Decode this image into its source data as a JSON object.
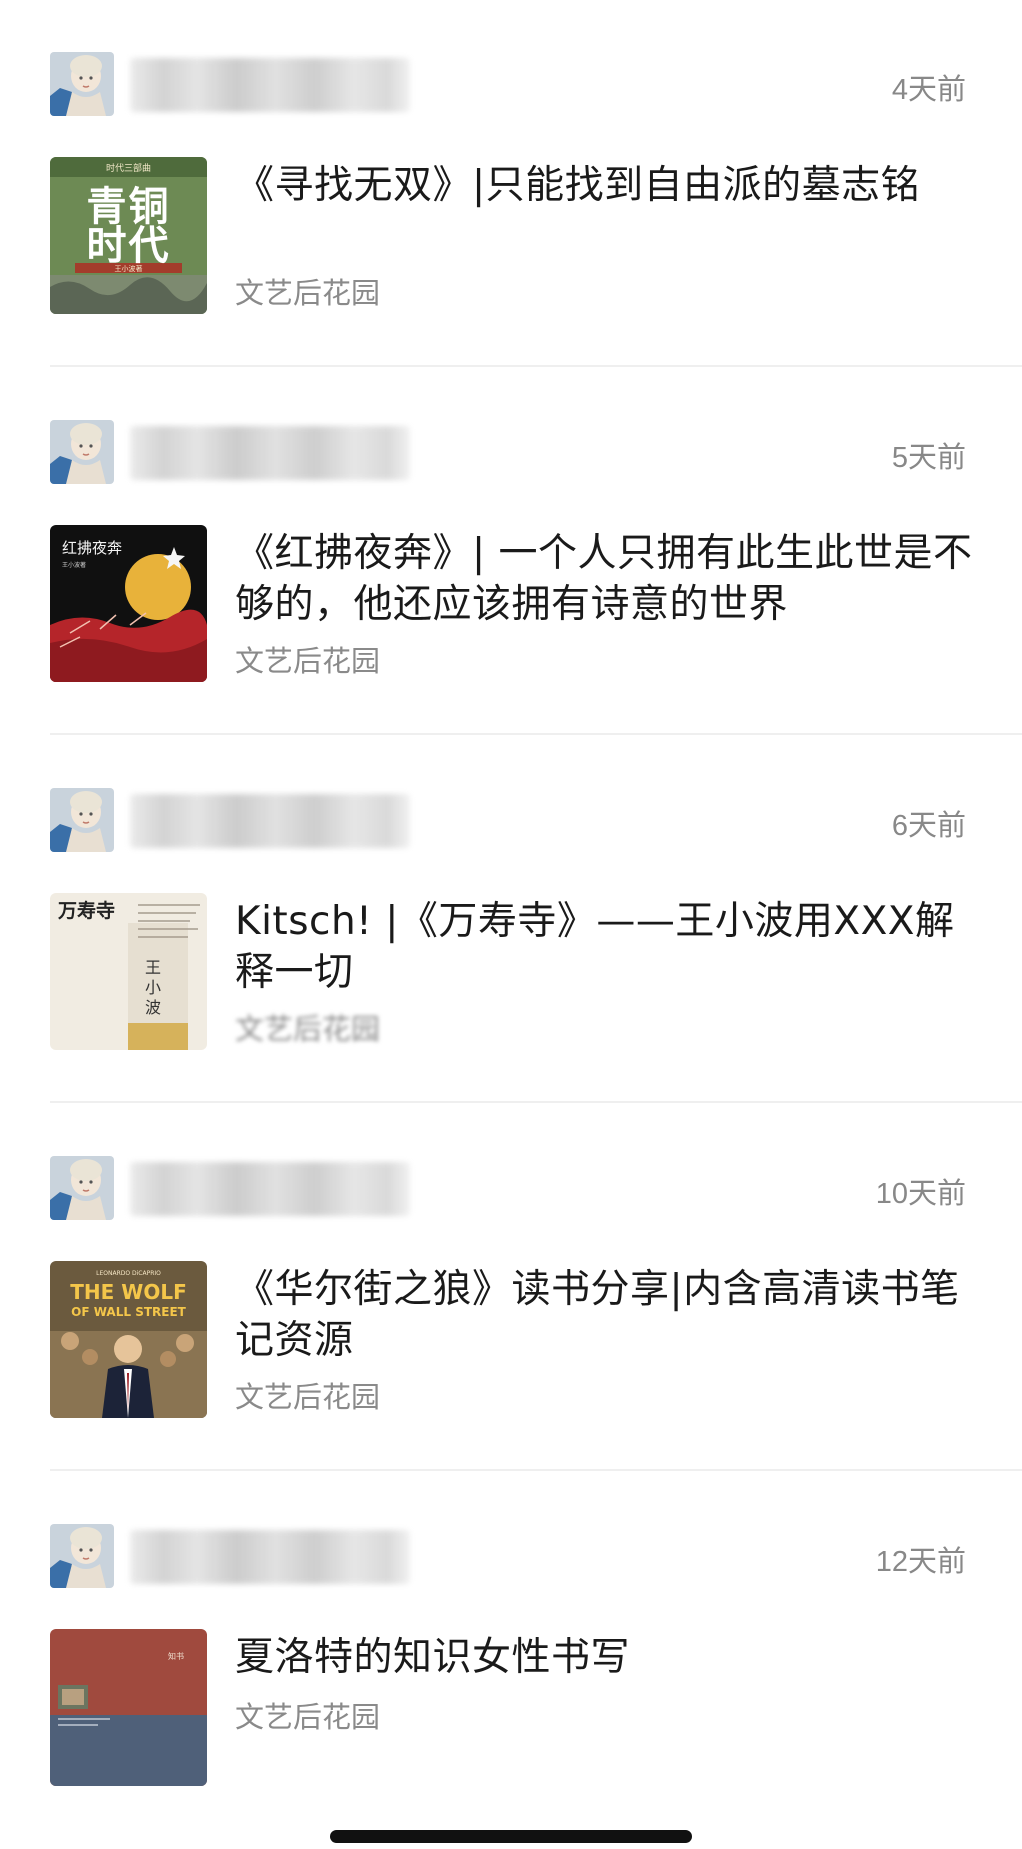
{
  "posts": [
    {
      "time": "4天前",
      "title": "《寻找无双》|只能找到自由派的墓志铭",
      "source": "文艺后花园",
      "cover": {
        "text": "青铜时代",
        "top_text": "时代三部曲",
        "bottom_text": "王小波著"
      }
    },
    {
      "time": "5天前",
      "title": "《红拂夜奔》| 一个人只拥有此生此世是不够的，他还应该拥有诗意的世界",
      "source": "文艺后花园",
      "cover": {
        "text": "红拂夜奔",
        "sub_text": "王小波著"
      }
    },
    {
      "time": "6天前",
      "title": "Kitsch! |《万寿寺》——王小波用XXX解释一切",
      "source": "文艺后花园",
      "cover": {
        "text": "万寿寺",
        "author": "王小波"
      }
    },
    {
      "time": "10天前",
      "title": "《华尔街之狼》读书分享|内含高清读书笔记资源",
      "source": "文艺后花园",
      "cover": {
        "text": "THE WOLF OF WALL STREET",
        "line1": "THE WOLF",
        "line2": "OF WALL STREET",
        "top_text": "LEONARDO DiCAPRIO"
      }
    },
    {
      "time": "12天前",
      "title": "夏洛特的知识女性书写",
      "source": "文艺后花园",
      "cover": {
        "text": "知书"
      }
    }
  ],
  "colors": {
    "time": "#888888",
    "source": "#8a8a8a",
    "divider": "#efefef"
  }
}
